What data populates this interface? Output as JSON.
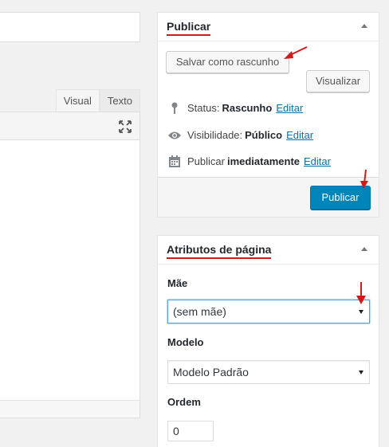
{
  "editor": {
    "tabs": [
      {
        "label": "Visual"
      },
      {
        "label": "Texto"
      }
    ],
    "expand_icon": "fullscreen-icon"
  },
  "publish_box": {
    "title": "Publicar",
    "save_draft_label": "Salvar como rascunho",
    "preview_label": "Visualizar",
    "status_prefix": "Status:",
    "status_value": "Rascunho",
    "visibility_prefix": "Visibilidade:",
    "visibility_value": "Público",
    "publish_prefix": "Publicar",
    "publish_value": "imediatamente",
    "edit_link": "Editar",
    "publish_button": "Publicar"
  },
  "attributes_box": {
    "title": "Atributos de página",
    "parent_label": "Mãe",
    "parent_value": "(sem mãe)",
    "template_label": "Modelo",
    "template_value": "Modelo Padrão",
    "order_label": "Ordem",
    "order_value": "0"
  },
  "colors": {
    "accent_blue": "#0085ba",
    "link_blue": "#0073aa",
    "annotation_red": "#d21a1a"
  }
}
